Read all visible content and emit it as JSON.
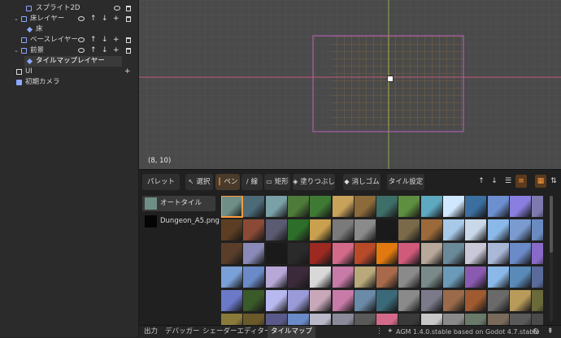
{
  "scene_tree": {
    "rows": [
      {
        "label": "スプライト2D",
        "icon": "sprite-icon",
        "level": 2
      },
      {
        "label": "床レイヤー",
        "icon": "layer-icon",
        "level": 1
      },
      {
        "label": "床",
        "icon": "tilemap-icon",
        "level": 2
      },
      {
        "label": "ベースレイヤー",
        "icon": "layer-icon",
        "level": 1
      },
      {
        "label": "前景",
        "icon": "layer-icon",
        "level": 1
      },
      {
        "label": "タイルマップレイヤー",
        "icon": "tilemap-icon",
        "level": 2
      },
      {
        "label": "UI",
        "icon": "ui-icon",
        "level": 0
      },
      {
        "label": "初期カメラ",
        "icon": "camera-icon",
        "level": 0
      }
    ]
  },
  "viewport": {
    "coords": "(8, 10)"
  },
  "toolbar": {
    "palette": "パレット",
    "select": "選択",
    "pen": "ペン",
    "line": "線",
    "rect": "矩形",
    "fill": "塗りつぶし",
    "eraser": "消しゴム",
    "tile_settings": "タイル設定"
  },
  "atlas": [
    {
      "label": "オートタイル"
    },
    {
      "label": "Dungeon_A5.png"
    }
  ],
  "tile_colors": [
    [
      "#6f8e86",
      "#4c6a78",
      "#7aa0a8",
      "#4e7a3a",
      "#3f7a35",
      "#c9a25a",
      "#8c6a3a",
      "#3e6e68",
      "#5e8f40",
      "#5ea8c0",
      "#d0e8ff",
      "#3b6fa0",
      "#6c8fd0",
      "#8a7ee0",
      "#7e7ab0"
    ],
    [
      "#5e3e22",
      "#8a4a35",
      "#5a5a70",
      "#2d6e2a",
      "#c8a04e",
      "#7a7a7a",
      "#8a8a8a",
      "#1a1a1a",
      "#7a6a4a",
      "#9c6a3a",
      "#a8c8e8",
      "#c8d8e8",
      "#8ab8e8",
      "#7a9ad0",
      "#6a8ac0"
    ],
    [
      "#5a3e2a",
      "#8a8ab8",
      "#1a1a1a",
      "#2a2a2a",
      "#9c2a22",
      "#d46a8a",
      "#b84a2a",
      "#e07a10",
      "#d05a7a",
      "#b8a89a",
      "#6a8a9a",
      "#c8c8d8",
      "#aab8d8",
      "#6a8ac8",
      "#8a6ac8"
    ],
    [
      "#7aa0d8",
      "#6a8ac8",
      "#b8a8d8",
      "#3a2a3a",
      "#d8d8d8",
      "#c87aa8",
      "#b8a87a",
      "#a86a4a",
      "#8a8a8a",
      "#7a8a8a",
      "#6a9ab8",
      "#8a5ab0",
      "#8ab8e8",
      "#5a8ab8",
      "#5a6a9a"
    ],
    [
      "#6a7ac8",
      "#3a5a2a",
      "#b8b8f0",
      "#9a9ad8",
      "#c8a8b8",
      "#c87aa8",
      "#6a8aa8",
      "#3a6a7a",
      "#8a8a8a",
      "#7a7a8a",
      "#9a6a4a",
      "#a05a30",
      "#6a6a6a",
      "#b89a5a",
      "#6a6a3a"
    ],
    [
      "#8a7a3a",
      "#6a5a2a",
      "#5a5a8a",
      "#6a8ac8",
      "#b8b8c8",
      "#8a8a9a",
      "#5a5a5a",
      "#d46a8a",
      "#3a3a3a",
      "#c8c8c8",
      "#8a8a8a",
      "#6a7a6a",
      "#7a6a5a",
      "#5a5a5a",
      "#4a4a4a"
    ]
  ],
  "status_bar": {
    "tabs": [
      "出力",
      "デバッガー",
      "シェーダーエディター",
      "タイルマップ"
    ],
    "version": "AGM 1.4.0.stable based on Godot 4.7.stable"
  }
}
